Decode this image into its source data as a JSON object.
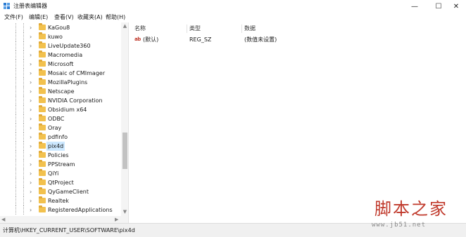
{
  "window": {
    "title": "注册表编辑器",
    "icon": "registry-editor-icon",
    "controls": {
      "minimize": "—",
      "maximize": "☐",
      "close": "✕"
    }
  },
  "menu": [
    "文件(F)",
    "编辑(E)",
    "查看(V)",
    "收藏夹(A)",
    "帮助(H)"
  ],
  "tree": {
    "items": [
      {
        "label": "KaGou8"
      },
      {
        "label": "kuwo"
      },
      {
        "label": "LiveUpdate360"
      },
      {
        "label": "Macromedia"
      },
      {
        "label": "Microsoft"
      },
      {
        "label": "Mosaic of CMImager"
      },
      {
        "label": "MozillaPlugins"
      },
      {
        "label": "Netscape"
      },
      {
        "label": "NVIDIA Corporation"
      },
      {
        "label": "Obsidium x64"
      },
      {
        "label": "ODBC"
      },
      {
        "label": "Oray"
      },
      {
        "label": "pdfinfo"
      },
      {
        "label": "pix4d",
        "selected": true
      },
      {
        "label": "Policies"
      },
      {
        "label": "PPStream"
      },
      {
        "label": "QiYi"
      },
      {
        "label": "QtProject"
      },
      {
        "label": "QyGameClient"
      },
      {
        "label": "Realtek"
      },
      {
        "label": "RegisteredApplications"
      }
    ],
    "scroll_position": 0.55
  },
  "list": {
    "columns": {
      "name": "名称",
      "type": "类型",
      "data": "数据"
    },
    "rows": [
      {
        "icon": "string-value-icon",
        "icon_text": "ab",
        "name": "(默认)",
        "type": "REG_SZ",
        "data": "(数值未设置)"
      }
    ]
  },
  "status": {
    "path": "计算机\\HKEY_CURRENT_USER\\SOFTWARE\\pix4d"
  },
  "watermark": {
    "main": "脚本之家",
    "sub": "www.jb51.net"
  },
  "colors": {
    "selection": "#cce8ff",
    "folder": "#f2c14e",
    "watermark": "#c0392b"
  }
}
